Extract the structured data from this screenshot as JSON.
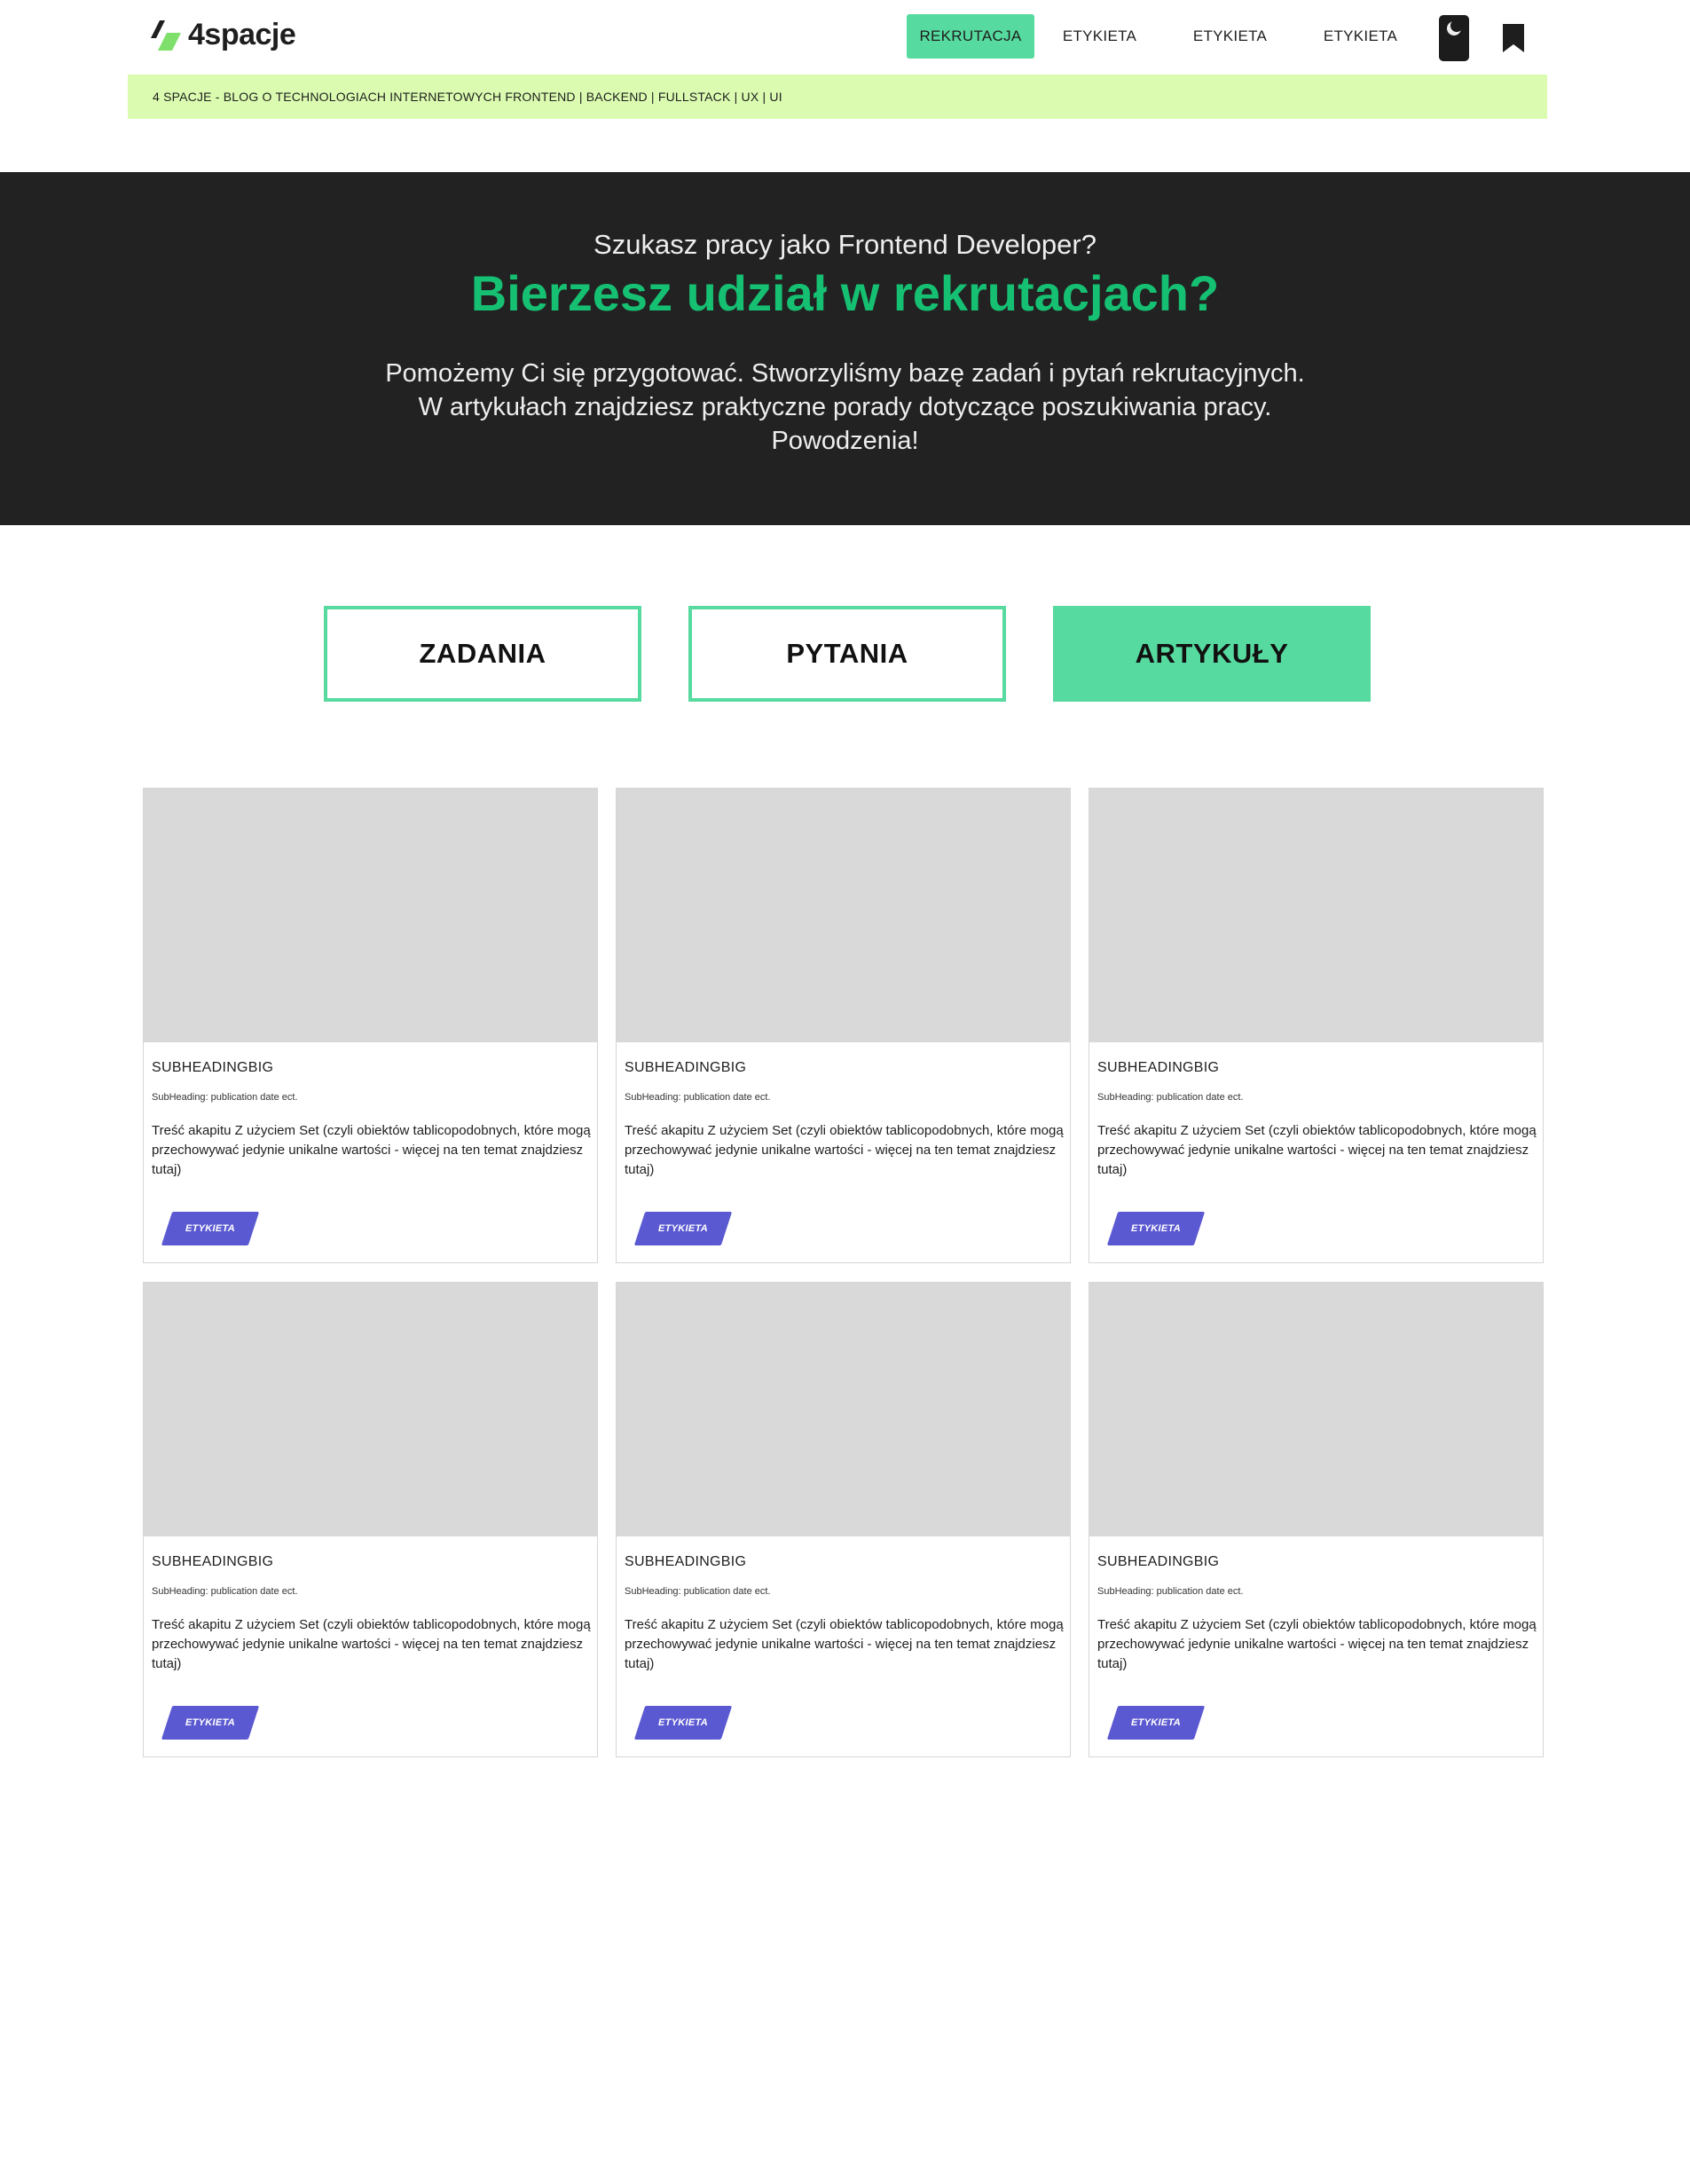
{
  "brand": {
    "name": "4spacje"
  },
  "nav": {
    "items": [
      {
        "label": "REKRUTACJA",
        "active": true
      },
      {
        "label": "ETYKIETA",
        "active": false
      },
      {
        "label": "ETYKIETA",
        "active": false
      },
      {
        "label": "ETYKIETA",
        "active": false
      }
    ],
    "theme_toggle_icon": "moon-icon",
    "bookmark_icon": "bookmark-icon"
  },
  "tagline": "4 SPACJE - BLOG O TECHNOLOGIACH INTERNETOWYCH FRONTEND | BACKEND | FULLSTACK | UX | UI",
  "hero": {
    "kicker": "Szukasz pracy jako Frontend Developer?",
    "title": "Bierzesz udział w rekrutacjach?",
    "lines": [
      "Pomożemy Ci się przygotować. Stworzyliśmy bazę zadań i pytań rekrutacyjnych.",
      "W artykułach znajdziesz praktyczne porady dotyczące poszukiwania pracy.",
      "Powodzenia!"
    ]
  },
  "tabs": [
    {
      "label": "ZADANIA",
      "active": false
    },
    {
      "label": "PYTANIA",
      "active": false
    },
    {
      "label": "ARTYKUŁY",
      "active": true
    }
  ],
  "cards": [
    {
      "title": "SUBHEADINGBIG",
      "subheading": "SubHeading: publication date ect.",
      "body": "Treść akapitu Z użyciem Set (czyli obiektów tablicopodobnych, które mogą przechowywać jedynie unikalne wartości - więcej na ten temat znajdziesz tutaj)",
      "tag": "ETYKIETA"
    },
    {
      "title": "SUBHEADINGBIG",
      "subheading": "SubHeading: publication date ect.",
      "body": "Treść akapitu Z użyciem Set (czyli obiektów tablicopodobnych, które mogą przechowywać jedynie unikalne wartości - więcej na ten temat znajdziesz tutaj)",
      "tag": "ETYKIETA"
    },
    {
      "title": "SUBHEADINGBIG",
      "subheading": "SubHeading: publication date ect.",
      "body": "Treść akapitu Z użyciem Set (czyli obiektów tablicopodobnych, które mogą przechowywać jedynie unikalne wartości - więcej na ten temat znajdziesz tutaj)",
      "tag": "ETYKIETA"
    },
    {
      "title": "SUBHEADINGBIG",
      "subheading": "SubHeading: publication date ect.",
      "body": "Treść akapitu Z użyciem Set (czyli obiektów tablicopodobnych, które mogą przechowywać jedynie unikalne wartości - więcej na ten temat znajdziesz tutaj)",
      "tag": "ETYKIETA"
    },
    {
      "title": "SUBHEADINGBIG",
      "subheading": "SubHeading: publication date ect.",
      "body": "Treść akapitu Z użyciem Set (czyli obiektów tablicopodobnych, które mogą przechowywać jedynie unikalne wartości - więcej na ten temat znajdziesz tutaj)",
      "tag": "ETYKIETA"
    },
    {
      "title": "SUBHEADINGBIG",
      "subheading": "SubHeading: publication date ect.",
      "body": "Treść akapitu Z użyciem Set (czyli obiektów tablicopodobnych, które mogą przechowywać jedynie unikalne wartości - więcej na ten temat znajdziesz tutaj)",
      "tag": "ETYKIETA"
    }
  ],
  "colors": {
    "accent": "#56da9f",
    "hero_title": "#16c072",
    "hero_bg": "#222222",
    "tagline_bg": "#dbfcb0",
    "tag_bg": "#5b59d1",
    "image_placeholder": "#d9d9d9"
  }
}
